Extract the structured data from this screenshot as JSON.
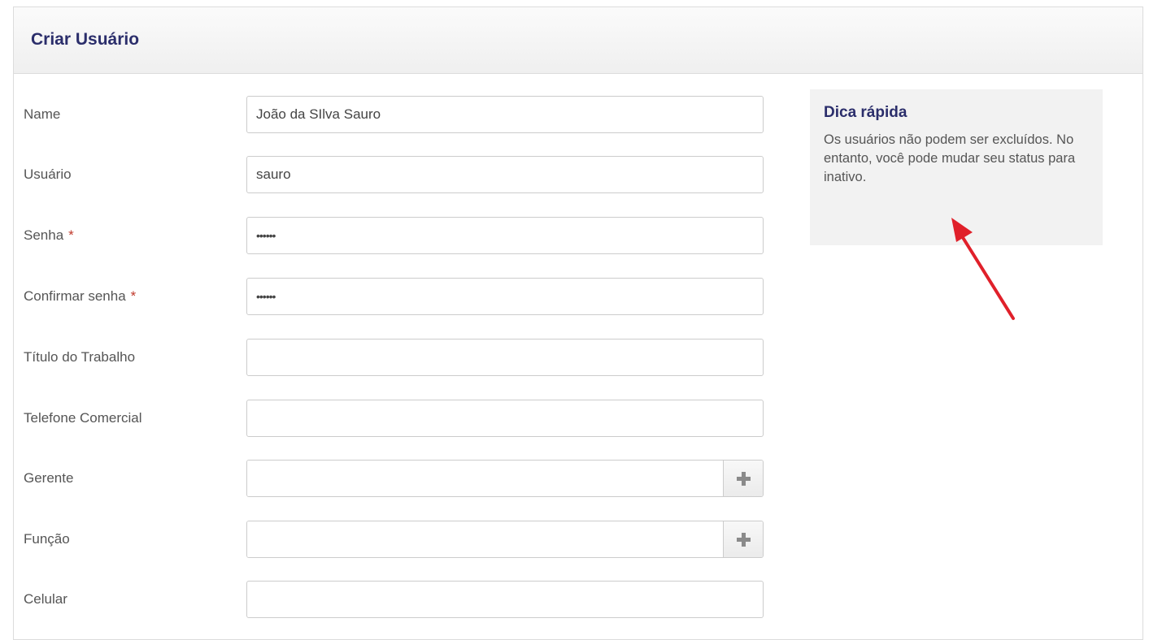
{
  "panel": {
    "title": "Criar Usuário"
  },
  "form": {
    "name": {
      "label": "Name",
      "value": "João da SIlva Sauro"
    },
    "usuario": {
      "label": "Usuário",
      "value": "sauro"
    },
    "senha": {
      "label": "Senha",
      "required_mark": "*",
      "value": "••••••"
    },
    "confirmar_senha": {
      "label": "Confirmar senha",
      "required_mark": "*",
      "value": "••••••"
    },
    "titulo_trabalho": {
      "label": "Título do Trabalho",
      "value": ""
    },
    "telefone_comercial": {
      "label": "Telefone Comercial",
      "value": ""
    },
    "gerente": {
      "label": "Gerente",
      "value": "",
      "add_icon": "plus-icon"
    },
    "funcao": {
      "label": "Função",
      "value": "",
      "add_icon": "plus-icon"
    },
    "celular": {
      "label": "Celular",
      "value": ""
    }
  },
  "tip": {
    "title": "Dica rápida",
    "text": "Os usuários não podem ser excluídos. No entanto, você pode mudar seu status para inativo."
  },
  "colors": {
    "title": "#2b2e6b",
    "required": "#c0392b",
    "annotation_arrow": "#e0202a",
    "tip_background": "#f2f2f2"
  }
}
